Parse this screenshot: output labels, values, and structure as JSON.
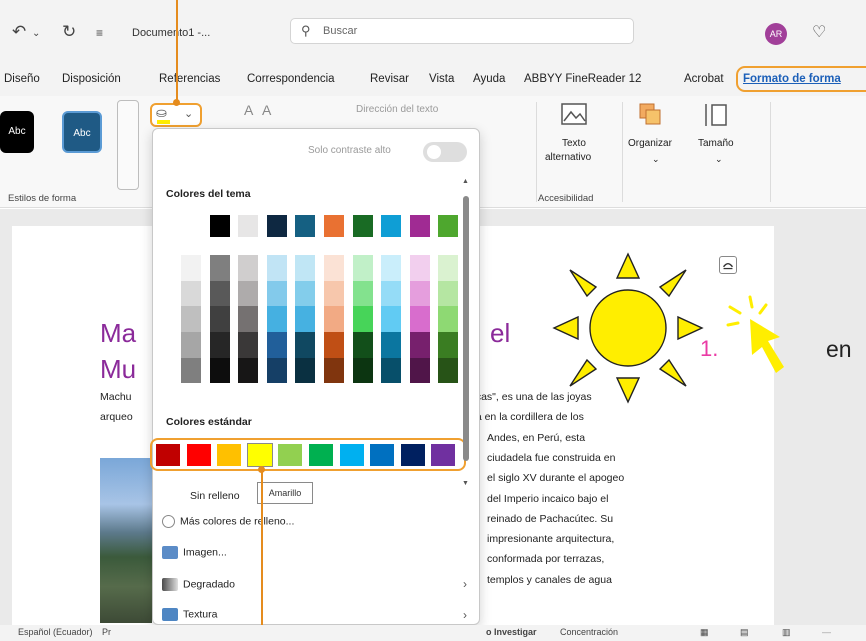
{
  "titlebar": {
    "doc_title": "Documento1 -...",
    "search_placeholder": "Buscar",
    "avatar_initials": "AR"
  },
  "menu": {
    "tabs": [
      "Diseño",
      "Disposición",
      "Referencias",
      "Correspondencia",
      "Revisar",
      "Vista",
      "Ayuda",
      "ABBYY FineReader 12",
      "Acrobat",
      "Formato de forma"
    ],
    "active": "Formato de forma"
  },
  "ribbon": {
    "style_sample": "Abc",
    "styles_group_label": "Estilos de forma",
    "text_direction": "Dirección del texto",
    "alt_text_label1": "Texto",
    "alt_text_label2": "alternativo",
    "accessibility_label": "Accesibilidad",
    "organize_label": "Organizar",
    "size_label": "Tamaño"
  },
  "dropdown": {
    "contrast_label": "Solo contraste alto",
    "theme_colors_title": "Colores del tema",
    "standard_colors_title": "Colores estándar",
    "no_fill": "Sin relleno",
    "more_colors": "Más colores de relleno...",
    "image": "Imagen...",
    "gradient": "Degradado",
    "texture": "Textura",
    "tooltip": "Amarillo",
    "theme_top_row": [
      "#ffffff",
      "#000000",
      "#e7e6e6",
      "#0e2841",
      "#156082",
      "#e97132",
      "#196b24",
      "#0f9ed5",
      "#a02b93",
      "#4ea72e"
    ],
    "theme_shades": [
      [
        "#f2f2f2",
        "#d9d9d9",
        "#bfbfbf",
        "#a6a6a6",
        "#7f7f7f"
      ],
      [
        "#7f7f7f",
        "#595959",
        "#404040",
        "#262626",
        "#0d0d0d"
      ],
      [
        "#d0cece",
        "#aeabab",
        "#757171",
        "#3a3838",
        "#171616"
      ],
      [
        "#c1e4f5",
        "#83caeb",
        "#45b0e1",
        "#215f9a",
        "#153f66"
      ],
      [
        "#c0e6f5",
        "#83cdeb",
        "#46b1e1",
        "#104861",
        "#0a3041"
      ],
      [
        "#fbe2d5",
        "#f7c7ac",
        "#f2aa84",
        "#c04f15",
        "#80350e"
      ],
      [
        "#c1f0c8",
        "#83e28e",
        "#47d459",
        "#124f1a",
        "#0c3511"
      ],
      [
        "#caeefb",
        "#95dcf7",
        "#61cbf3",
        "#0b76a0",
        "#074f6a"
      ],
      [
        "#f2cfee",
        "#e59edd",
        "#d86dcd",
        "#77206d",
        "#501549"
      ],
      [
        "#daf2d0",
        "#b5e6a2",
        "#8ed973",
        "#3a7d22",
        "#275317"
      ]
    ],
    "standard_colors": [
      "#c00000",
      "#ff0000",
      "#ffc000",
      "#ffff00",
      "#92d050",
      "#00b050",
      "#00b0f0",
      "#0070c0",
      "#002060",
      "#7030a0"
    ]
  },
  "document": {
    "heading_left_1": "Ma",
    "heading_left_2": "Mu",
    "heading_right": "el",
    "left_line_1": "Machu",
    "left_line_2": "arqueo",
    "right_lines": [
      "ncas\", es una de las joyas",
      "da en la cordillera de los",
      "Andes, en Perú, esta",
      "ciudadela fue construida en",
      "el siglo XV durante el apogeo",
      "del Imperio incaico bajo el",
      "reinado de Pachacútec. Su",
      "impresionante arquitectura,",
      "conformada por terrazas,",
      "templos y canales de agua"
    ],
    "step_number": "1.",
    "step_text": "en"
  },
  "statusbar": {
    "language": "Español (Ecuador)",
    "pr": "Pr",
    "investigar": "o Investigar",
    "focus": "Concentración"
  },
  "colors": {
    "accent_orange": "#f0a030",
    "heading_purple": "#8b2a9a",
    "active_tab_blue": "#1b5fb8",
    "sun_yellow": "#ffee00",
    "step_pink": "#ea3aa5"
  }
}
